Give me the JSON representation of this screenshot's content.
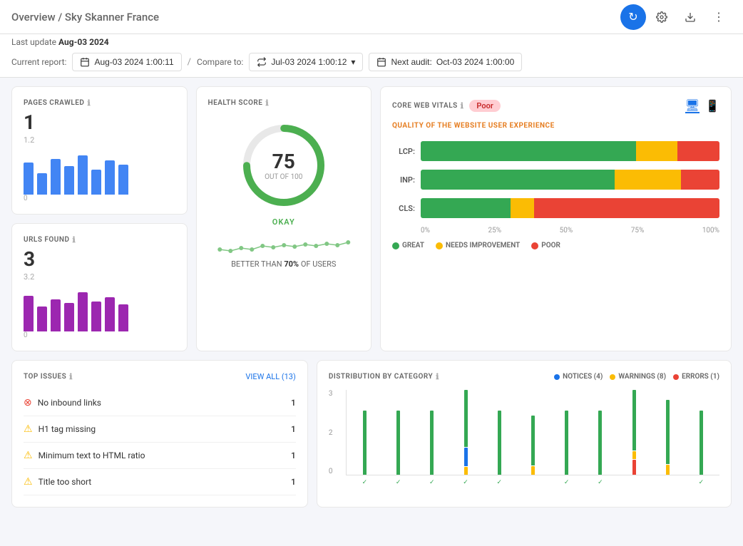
{
  "header": {
    "title": "Overview",
    "separator": "/",
    "subtitle": "Sky Skanner France",
    "last_update_label": "Last update",
    "last_update_date": "Aug-03 2024"
  },
  "report_bar": {
    "current_label": "Current report:",
    "compare_label": "Compare to:",
    "current_date": "Aug-03 2024 1:00:11",
    "compare_date": "Jul-03 2024 1:00:12",
    "next_audit_label": "Next audit:",
    "next_audit_date": "Oct-03 2024 1:00:00",
    "separator": "/"
  },
  "pages_crawled": {
    "title": "PAGES CRAWLED",
    "value": "1",
    "scale_top": "1.2",
    "scale_bottom": "0"
  },
  "urls_found": {
    "title": "URLS FOUND",
    "value": "3",
    "scale_top": "3.2",
    "scale_bottom": "0"
  },
  "health_score": {
    "title": "HEALTH SCORE",
    "score": "75",
    "out_of": "OUT OF 100",
    "status": "OKAY",
    "better_than_prefix": "BETTER THAN",
    "better_than_pct": "70%",
    "better_than_suffix": "OF USERS"
  },
  "core_web_vitals": {
    "title": "CORE WEB VITALS",
    "badge": "Poor",
    "subtitle": "QUALITY OF THE WEBSITE USER EXPERIENCE",
    "metrics": [
      {
        "label": "LCP:",
        "green": 72,
        "yellow": 14,
        "red": 14
      },
      {
        "label": "INP:",
        "green": 65,
        "yellow": 22,
        "red": 13
      },
      {
        "label": "CLS:",
        "green": 30,
        "yellow": 8,
        "red": 62
      }
    ],
    "axis": [
      "0%",
      "25%",
      "50%",
      "75%",
      "100%"
    ],
    "legend": [
      {
        "label": "GREAT",
        "color": "#34a853"
      },
      {
        "label": "NEEDS IMPROVEMENT",
        "color": "#fbbc04"
      },
      {
        "label": "POOR",
        "color": "#ea4335"
      }
    ]
  },
  "top_issues": {
    "title": "TOP ISSUES",
    "view_all": "VIEW ALL (13)",
    "issues": [
      {
        "icon": "error",
        "text": "No inbound links",
        "count": "1"
      },
      {
        "icon": "warning",
        "text": "H1 tag missing",
        "count": "1"
      },
      {
        "icon": "warning",
        "text": "Minimum text to HTML ratio",
        "count": "1"
      },
      {
        "icon": "warning",
        "text": "Title too short",
        "count": "1"
      }
    ]
  },
  "distribution": {
    "title": "DISTRIBUTION BY CATEGORY",
    "legend": [
      {
        "label": "NOTICES (4)",
        "color": "#1a73e8"
      },
      {
        "label": "WARNINGS (8)",
        "color": "#fbbc04"
      },
      {
        "label": "ERRORS (1)",
        "color": "#ea4335"
      }
    ],
    "y_labels": [
      "3",
      "2",
      "0"
    ],
    "columns": [
      {
        "teal": 100,
        "blue": 0,
        "yellow": 0,
        "red": 0,
        "check": true
      },
      {
        "teal": 100,
        "blue": 0,
        "yellow": 0,
        "red": 0,
        "check": true
      },
      {
        "teal": 100,
        "blue": 0,
        "yellow": 0,
        "red": 0,
        "check": true
      },
      {
        "teal": 100,
        "blue": 80,
        "yellow": 30,
        "red": 0,
        "check": true
      },
      {
        "teal": 100,
        "blue": 0,
        "yellow": 0,
        "red": 0,
        "check": true
      },
      {
        "teal": 90,
        "blue": 0,
        "yellow": 20,
        "red": 0,
        "check": false
      },
      {
        "teal": 100,
        "blue": 0,
        "yellow": 0,
        "red": 0,
        "check": true
      },
      {
        "teal": 100,
        "blue": 0,
        "yellow": 0,
        "red": 0,
        "check": true
      },
      {
        "teal": 100,
        "blue": 0,
        "yellow": 20,
        "red": 60,
        "red2": true,
        "check": false
      },
      {
        "teal": 100,
        "blue": 0,
        "yellow": 30,
        "red": 0,
        "check": false
      },
      {
        "teal": 100,
        "blue": 0,
        "yellow": 0,
        "red": 0,
        "check": true
      }
    ]
  }
}
